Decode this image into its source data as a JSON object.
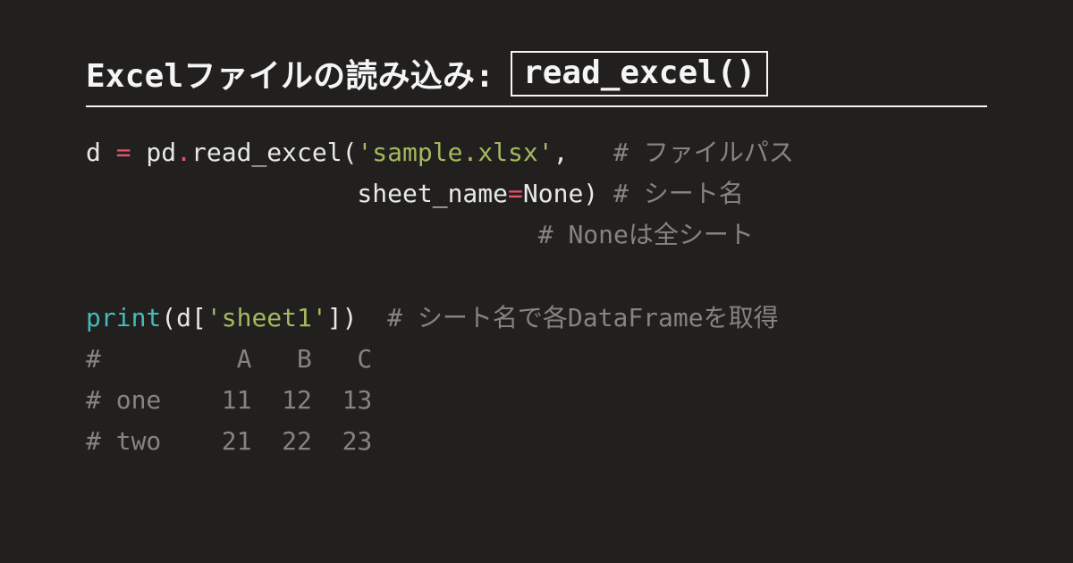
{
  "title": {
    "text": "Excelファイルの読み込み:",
    "code": "read_excel()"
  },
  "code": {
    "l1": {
      "a": "d ",
      "b": "=",
      "c": " pd",
      "d": ".",
      "e": "read_excel(",
      "f": "'sample.xlsx'",
      "g": ",   ",
      "h": "# ファイルパス"
    },
    "l2": {
      "a": "                  sheet_name",
      "b": "=",
      "c": "None) ",
      "d": "# シート名"
    },
    "l3": {
      "a": "                              ",
      "b": "# Noneは全シート"
    },
    "l4": {
      "a": ""
    },
    "l5": {
      "a": "print",
      "b": "(d[",
      "c": "'sheet1'",
      "d": "])  ",
      "e": "# シート名で各DataFrameを取得"
    },
    "l6": {
      "a": "#         A   B   C"
    },
    "l7": {
      "a": "# one    11  12  13"
    },
    "l8": {
      "a": "# two    21  22  23"
    }
  }
}
